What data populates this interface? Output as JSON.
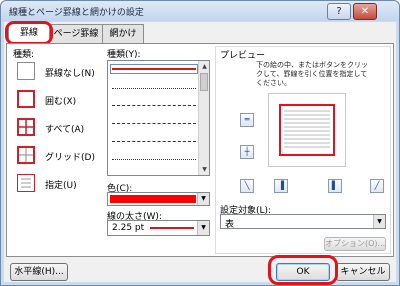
{
  "window": {
    "title": "線種とページ罫線と網かけの設定",
    "help": "?",
    "close": "✕"
  },
  "tabs": [
    {
      "label": "罫線"
    },
    {
      "label": "ページ罫線"
    },
    {
      "label": "網かけ"
    }
  ],
  "settings": {
    "heading": "種類:",
    "items": [
      {
        "label": "罫線なし(N)"
      },
      {
        "label": "囲む(X)"
      },
      {
        "label": "すべて(A)"
      },
      {
        "label": "グリッド(D)"
      },
      {
        "label": "指定(U)"
      }
    ]
  },
  "style": {
    "heading": "種類(Y):"
  },
  "color": {
    "label": "色(C):",
    "value": "#ff0000"
  },
  "width": {
    "label": "線の太さ(W):",
    "value": "2.25 pt"
  },
  "preview": {
    "heading": "プレビュー",
    "instruction": "下の絵の中、またはボタンをクリックして、罫線を引く位置を指定してください。"
  },
  "apply_to": {
    "label": "設定対象(L):",
    "value": "表"
  },
  "buttons": {
    "options": "オプション(O)...",
    "horizontal_line": "水平線(H)...",
    "ok": "OK",
    "cancel": "キャンセル"
  },
  "accent_colors": {
    "highlight": "#e0141e",
    "border": "#d0212a"
  }
}
